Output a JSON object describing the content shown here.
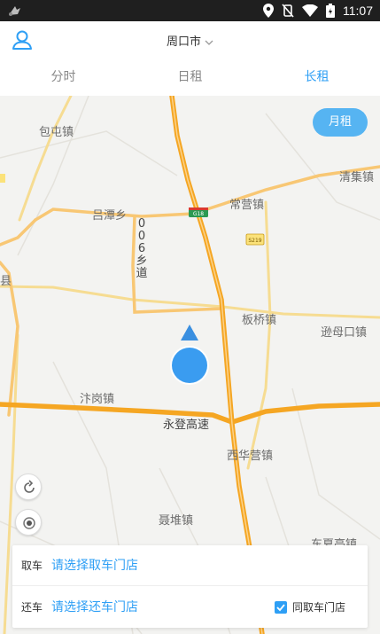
{
  "status_bar": {
    "time": "11:07"
  },
  "header": {
    "city": "周口市"
  },
  "tabs": [
    {
      "label": "分时",
      "active": false
    },
    {
      "label": "日租",
      "active": false
    },
    {
      "label": "长租",
      "active": true
    }
  ],
  "map": {
    "monthly_button": "月租",
    "labels": {
      "baotun": "包屯镇",
      "qingji": "清集镇",
      "lvtan": "吕潭乡",
      "changying": "常营镇",
      "banqiao": "板桥镇",
      "dumukou": "逊母口镇",
      "fugang": "汴岗镇",
      "yongdeng": "永登高速",
      "xihuaying": "西华营镇",
      "niedui": "聂堆镇",
      "dongxiating": "东夏亭镇",
      "county": "县",
      "road_006": [
        "0",
        "0",
        "6",
        "乡",
        "道"
      ],
      "shield_g": "G18",
      "shield_s": "S219"
    }
  },
  "pickup": {
    "label": "取车",
    "placeholder": "请选择取车门店"
  },
  "dropoff": {
    "label": "还车",
    "placeholder": "请选择还车门店",
    "same_store_label": "同取车门店",
    "same_store_checked": true
  },
  "colors": {
    "accent": "#2e9ff5",
    "highway": "#f5a623"
  }
}
